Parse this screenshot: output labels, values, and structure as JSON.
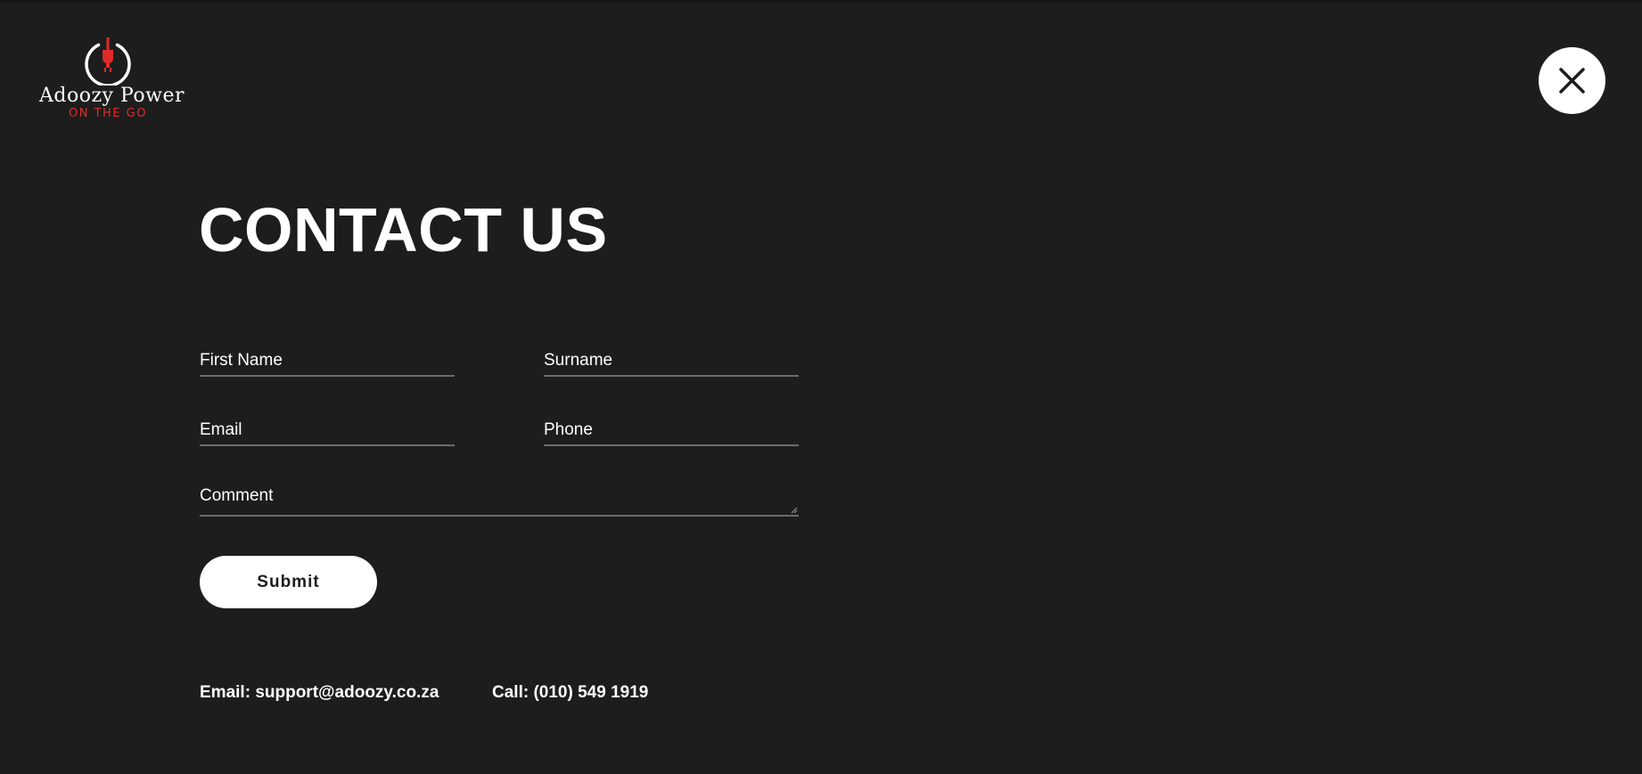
{
  "brand": {
    "name": "Adoozy Power",
    "tagline": "ON THE GO",
    "logo_icon": "power-plug-icon",
    "accent_color": "#e02a2a"
  },
  "header": {
    "close_icon": "close-icon"
  },
  "page": {
    "title": "CONTACT US",
    "background_color": "#1d1d1d"
  },
  "form": {
    "first_name": {
      "value": "",
      "placeholder": "First Name"
    },
    "surname": {
      "value": "",
      "placeholder": "Surname"
    },
    "email": {
      "value": "",
      "placeholder": "Email"
    },
    "phone": {
      "value": "",
      "placeholder": "Phone"
    },
    "comment": {
      "value": "",
      "placeholder": "Comment"
    },
    "submit_label": "Submit"
  },
  "contact": {
    "email_prefix": "Email: ",
    "email": "support@adoozy.co.za",
    "phone_prefix": "Call: ",
    "phone": "(010) 549 1919"
  }
}
